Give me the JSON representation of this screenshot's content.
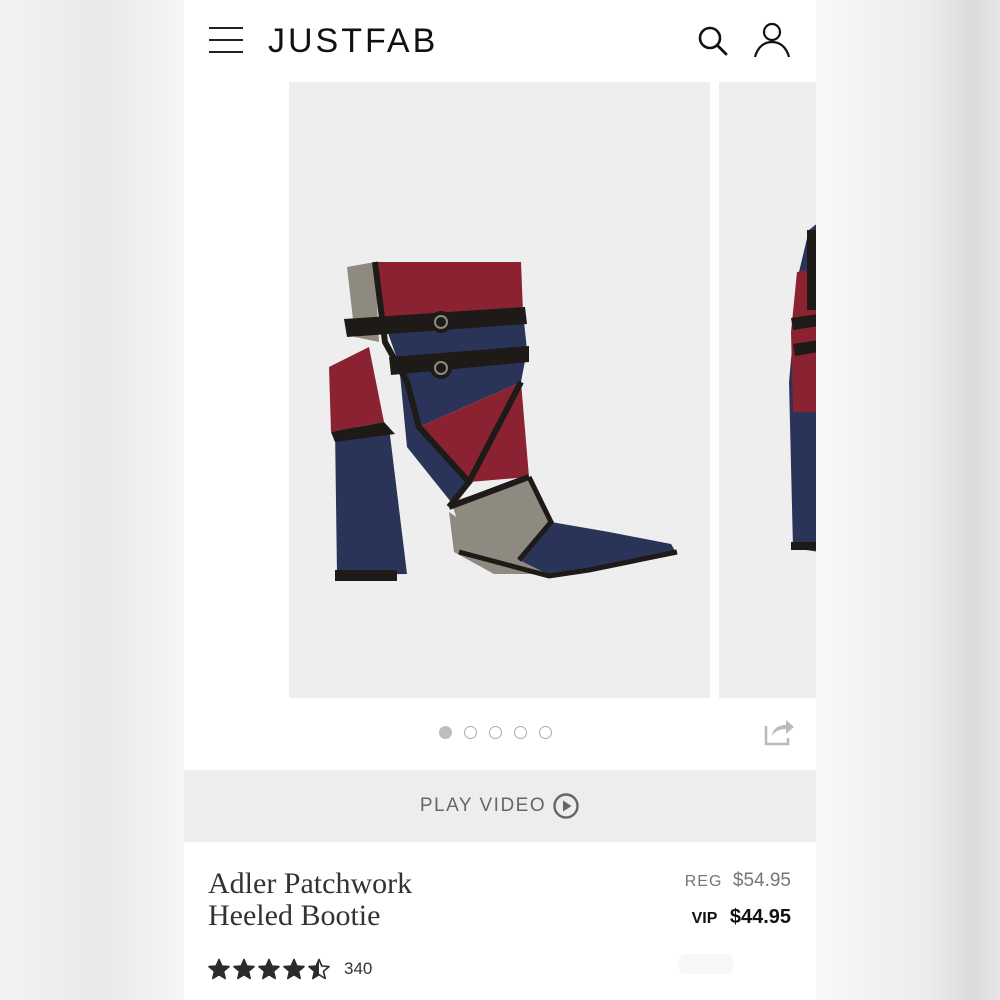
{
  "header": {
    "logo": "JUSTFAB",
    "menu_icon": "hamburger-menu-icon",
    "search_icon": "search-icon",
    "account_icon": "account-icon"
  },
  "carousel": {
    "image_count": 5,
    "active_index": 0,
    "share_icon": "share-icon"
  },
  "video": {
    "label": "PLAY VIDEO",
    "icon": "play-circle-icon"
  },
  "product": {
    "title_line1": "Adler Patchwork",
    "title_line2": "Heeled Bootie",
    "reg_label": "REG",
    "reg_price": "$54.95",
    "vip_label": "VIP",
    "vip_price": "$44.95",
    "rating": 4.5,
    "review_count": "340"
  },
  "colors": {
    "boot_burgundy": "#8a2231",
    "boot_navy": "#2a3358",
    "boot_taupe": "#8f8a80",
    "boot_black": "#1e1a18",
    "star": "#2b2b2b"
  }
}
